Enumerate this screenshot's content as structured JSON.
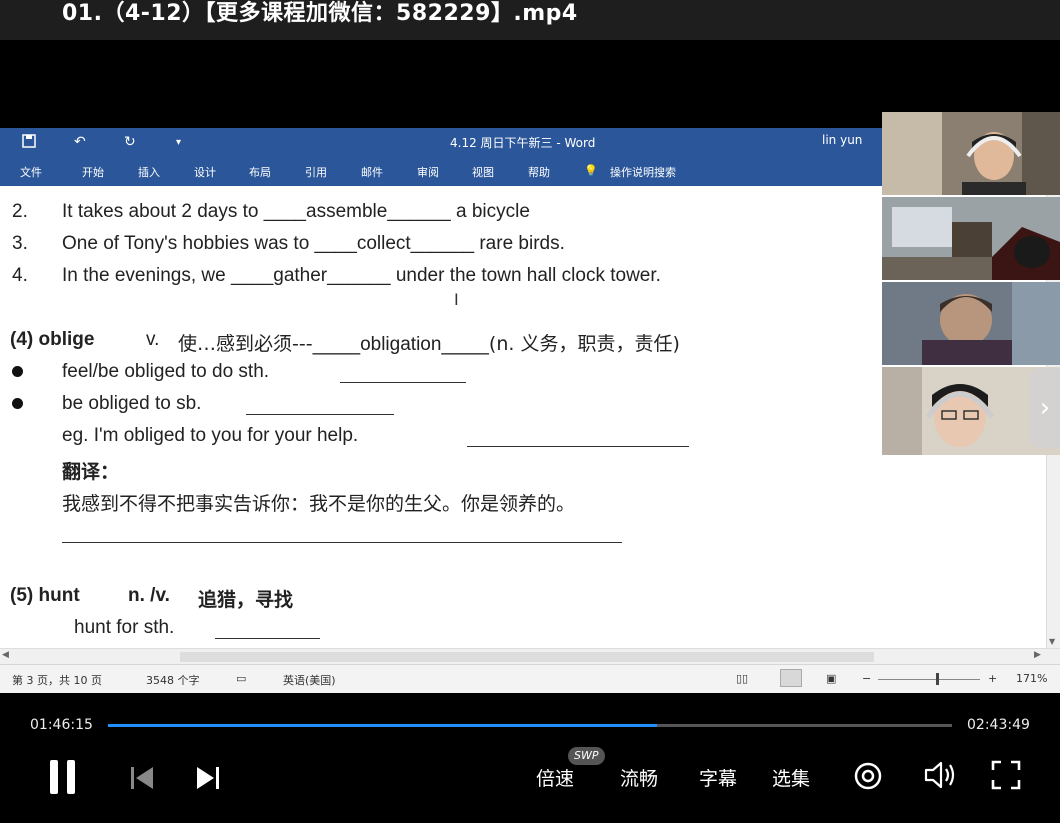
{
  "video": {
    "title": "01.（4-12）【更多课程加微信：582229】.mp4"
  },
  "word": {
    "doc_title": "4.12 周日下午新三 - Word",
    "user": "lin yun",
    "tabs": [
      "文件",
      "开始",
      "插入",
      "设计",
      "布局",
      "引用",
      "邮件",
      "审阅",
      "视图",
      "帮助"
    ],
    "tell_me": "操作说明搜索",
    "status": {
      "page": "第 3 页，共 10 页",
      "words": "3548 个字",
      "language": "英语(美国)",
      "zoom": "171%"
    }
  },
  "document": {
    "items": [
      {
        "num": "2.",
        "pre": "It takes about 2 days to ____",
        "answer": "assemble",
        "post": "______ a bicycle"
      },
      {
        "num": "3.",
        "pre": "One of Tony's hobbies was to ____",
        "answer": "collect",
        "post": "______ rare birds."
      },
      {
        "num": "4.",
        "pre": "In the evenings, we ____",
        "answer": "gather",
        "post": "______ under the town hall clock tower."
      }
    ],
    "oblige": {
      "head": "(4) oblige",
      "pos": "v.",
      "meaning": "使…感到必须---_____",
      "answer": "obligation",
      "tail": "_____(n.  义务，职责，责任)",
      "bullet1": "feel/be obliged to do sth.",
      "bullet2": "be obliged to sb.",
      "eg": "eg. I'm obliged to you for your help.",
      "translate_label": "翻译：",
      "translate_text": "我感到不得不把事实告诉你：我不是你的生父。你是领养的。"
    },
    "hunt": {
      "head": "(5) hunt",
      "pos": "n. /v.",
      "meaning": "追猎，寻找",
      "line": "hunt for sth."
    }
  },
  "player": {
    "current_time": "01:46:15",
    "total_time": "02:43:49",
    "progress": 0.65,
    "swp_badge": "SWP",
    "speed": "倍速",
    "quality": "流畅",
    "subtitle": "字幕",
    "episodes": "选集"
  }
}
